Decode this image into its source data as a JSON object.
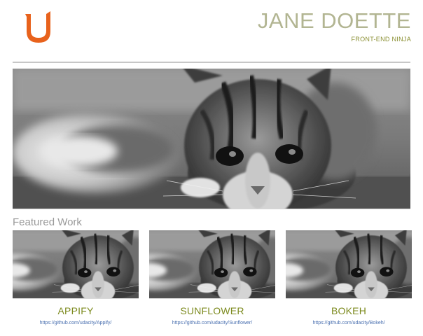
{
  "header": {
    "name": "JANE DOETTE",
    "tagline": "FRONT-END NINJA",
    "logo_icon": "udacity-logo-icon",
    "logo_color": "#e8621c"
  },
  "featured": {
    "title": "Featured Work",
    "items": [
      {
        "title": "APPIFY",
        "link": "https://github.com/udacity/Appify/"
      },
      {
        "title": "SUNFLOWER",
        "link": "https://github.com/udacity/Sunflower/"
      },
      {
        "title": "BOKEH",
        "link": "https://github.com/udacity/Bokeh/"
      }
    ]
  },
  "colors": {
    "name": "#b2b592",
    "tagline": "#8a8f32",
    "work_title": "#7c8a1e",
    "link": "#4a70b0"
  }
}
